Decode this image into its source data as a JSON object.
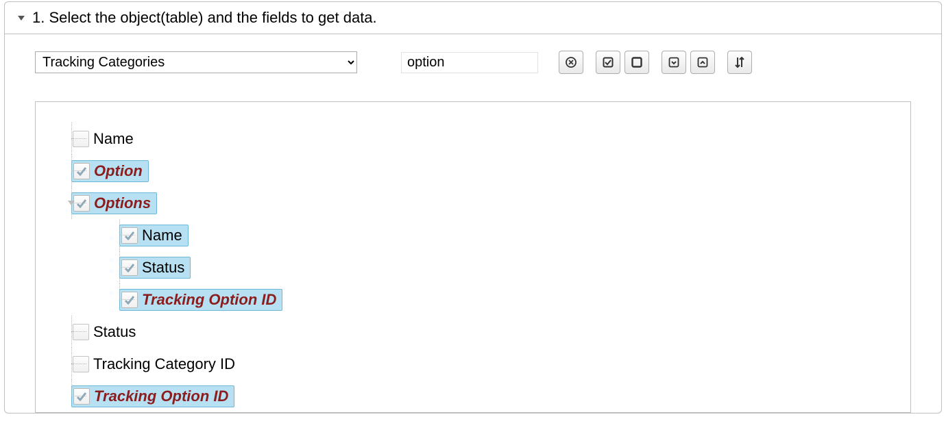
{
  "header": {
    "title": "1. Select the object(table) and the fields to get data."
  },
  "toolbar": {
    "object_selected": "Tracking Categories",
    "filter_value": "option"
  },
  "tree": {
    "nodes": [
      {
        "label": "Name",
        "checked": false,
        "selected": false,
        "match": false,
        "expanded": false,
        "last": false
      },
      {
        "label": "Option",
        "checked": true,
        "selected": true,
        "match": true,
        "expanded": false,
        "last": false
      },
      {
        "label": "Options",
        "checked": true,
        "selected": true,
        "match": true,
        "expanded": true,
        "last": false,
        "children": [
          {
            "label": "Name",
            "checked": true,
            "selected": true,
            "match": false,
            "last": false
          },
          {
            "label": "Status",
            "checked": true,
            "selected": true,
            "match": false,
            "last": false
          },
          {
            "label": "Tracking Option ID",
            "checked": true,
            "selected": true,
            "match": true,
            "last": true
          }
        ]
      },
      {
        "label": "Status",
        "checked": false,
        "selected": false,
        "match": false,
        "expanded": false,
        "last": false
      },
      {
        "label": "Tracking Category ID",
        "checked": false,
        "selected": false,
        "match": false,
        "expanded": false,
        "last": false
      },
      {
        "label": "Tracking Option ID",
        "checked": true,
        "selected": true,
        "match": true,
        "expanded": false,
        "last": true
      }
    ]
  }
}
